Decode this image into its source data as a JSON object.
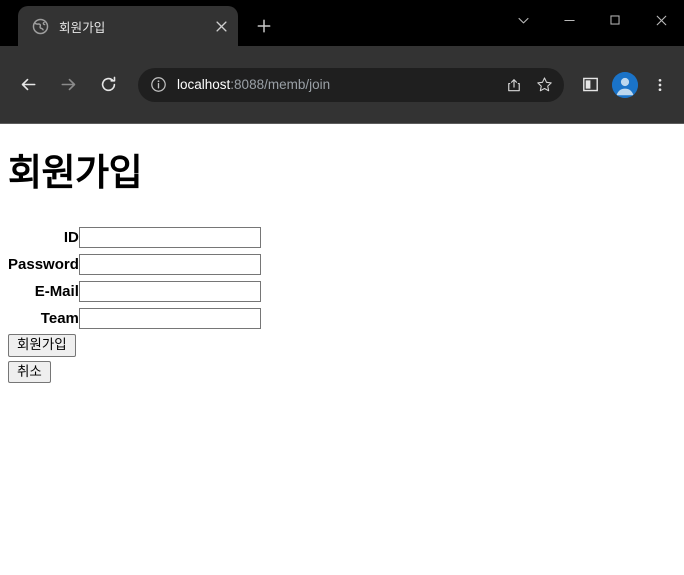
{
  "browser": {
    "tab": {
      "title": "회원가입",
      "favicon": "globe-icon",
      "close_label": "×"
    },
    "new_tab_label": "+",
    "window_controls": {
      "tab_search": "tab-search-chevron",
      "minimize": "minimize",
      "maximize": "maximize",
      "close": "close"
    },
    "nav": {
      "back": "back-arrow",
      "forward": "forward-arrow",
      "reload": "reload"
    },
    "omnibox": {
      "site_info": "info-circle-icon",
      "url_host": "localhost",
      "url_rest": ":8088/memb/join",
      "url_full": "localhost:8088/memb/join",
      "share": "share-icon",
      "bookmark": "star-icon"
    },
    "toolbar": {
      "side_panel": "side-panel-icon",
      "profile": "profile-avatar",
      "menu": "three-dot-menu-icon"
    }
  },
  "page": {
    "title": "회원가입",
    "fields": [
      {
        "label": "ID",
        "value": "",
        "placeholder": "",
        "name": "id-field"
      },
      {
        "label": "Password",
        "value": "",
        "placeholder": "",
        "name": "password-field"
      },
      {
        "label": "E-Mail",
        "value": "",
        "placeholder": "",
        "name": "email-field"
      },
      {
        "label": "Team",
        "value": "",
        "placeholder": "",
        "name": "team-field"
      }
    ],
    "buttons": {
      "submit": "회원가입",
      "cancel": "취소"
    }
  },
  "colors": {
    "chrome_tabstrip": "#000000",
    "chrome_toolbar": "#333333",
    "tab_active": "#333333",
    "omnibox": "#1f1f1f",
    "url_host_text": "#ffffff",
    "url_rest_text": "#9aa0a6",
    "avatar_blue": "#1a73c8",
    "page_bg": "#ffffff",
    "page_text": "#000000",
    "input_border": "#767676",
    "button_bg": "#efefef"
  }
}
